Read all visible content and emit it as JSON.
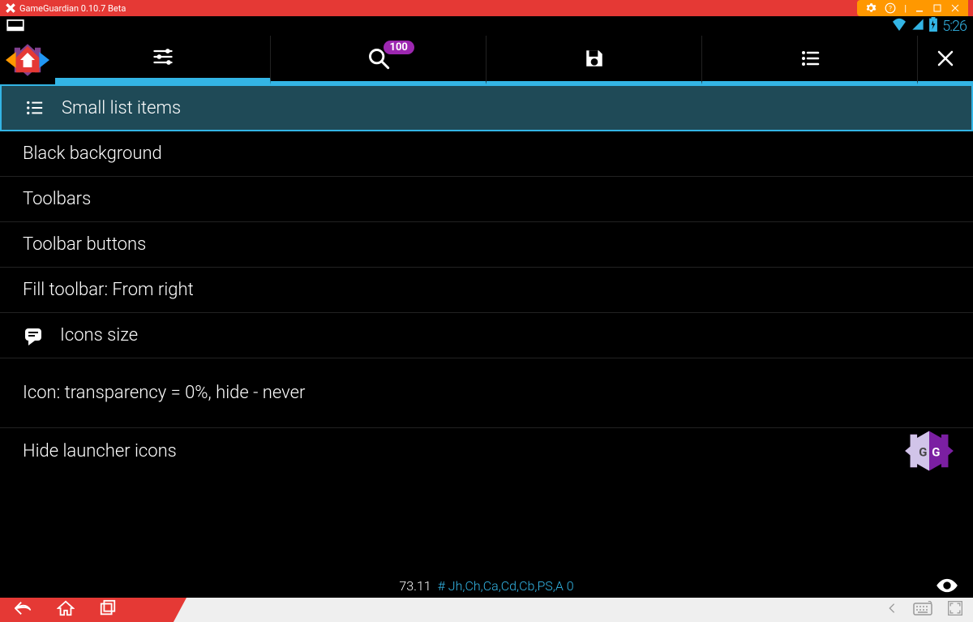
{
  "emulator": {
    "title": "GameGuardian 0.10.7 Beta"
  },
  "statusbar": {
    "time": "5:26"
  },
  "tabs": {
    "search_badge": "100"
  },
  "settings": {
    "items": {
      "small_list": "Small list items",
      "black_bg": "Black background",
      "toolbars": "Toolbars",
      "toolbar_buttons": "Toolbar buttons",
      "fill_toolbar": "Fill toolbar: From right",
      "icons_size": "Icons size",
      "icon_transparency": "Icon: transparency = 0%, hide - never",
      "hide_launcher": "Hide launcher icons"
    }
  },
  "bottom_status": {
    "version": "73.11",
    "tags": "# Jh,Ch,Ca,Cd,Cb,PS,A 0"
  }
}
